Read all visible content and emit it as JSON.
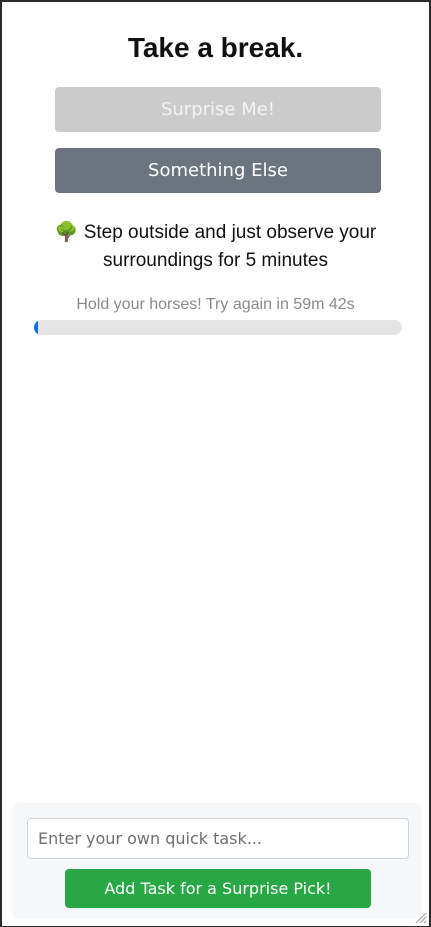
{
  "header": {
    "title": "Take a break."
  },
  "actions": {
    "surprise_label": "Surprise Me!",
    "something_else_label": "Something Else"
  },
  "suggestion": {
    "emoji": "🌳",
    "text": "Step outside and just observe your surroundings for 5 minutes"
  },
  "cooldown": {
    "message": "Hold your horses! Try again in 59m 42s",
    "progress_fraction": 0.01
  },
  "footer": {
    "input_placeholder": "Enter your own quick task...",
    "input_value": "",
    "add_button_label": "Add Task for a Surprise Pick!"
  },
  "colors": {
    "surprise_disabled": "#cbcbcb",
    "something_else": "#6c757d",
    "progress_fill": "#0d6efd",
    "add_button": "#28a745"
  },
  "icons": {
    "suggestion_icon": "tree-icon",
    "corner": "resize-grip-icon"
  }
}
